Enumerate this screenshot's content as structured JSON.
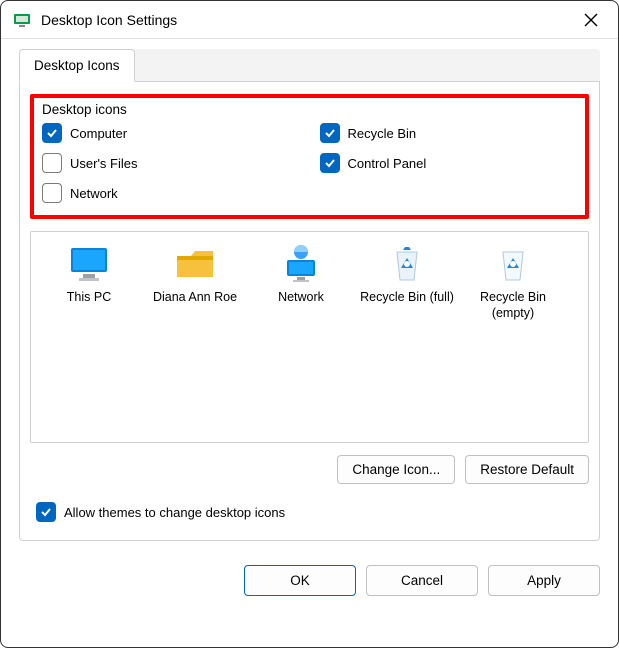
{
  "window": {
    "title": "Desktop Icon Settings"
  },
  "tab": {
    "label": "Desktop Icons"
  },
  "group": {
    "caption": "Desktop icons",
    "items": {
      "computer": {
        "label": "Computer",
        "checked": true
      },
      "recycle": {
        "label": "Recycle Bin",
        "checked": true
      },
      "userfiles": {
        "label": "User's Files",
        "checked": false
      },
      "controlpanel": {
        "label": "Control Panel",
        "checked": true
      },
      "network": {
        "label": "Network",
        "checked": false
      }
    }
  },
  "preview": {
    "thispc": "This PC",
    "user": "Diana Ann Roe",
    "network": "Network",
    "recyclefull": "Recycle Bin (full)",
    "recycleempty": "Recycle Bin (empty)"
  },
  "buttons": {
    "change_icon": "Change Icon...",
    "restore_default": "Restore Default"
  },
  "themes_checkbox": {
    "label": "Allow themes to change desktop icons",
    "checked": true
  },
  "footer": {
    "ok": "OK",
    "cancel": "Cancel",
    "apply": "Apply"
  },
  "colors": {
    "accent": "#0067c0",
    "highlight": "#ff0000"
  }
}
